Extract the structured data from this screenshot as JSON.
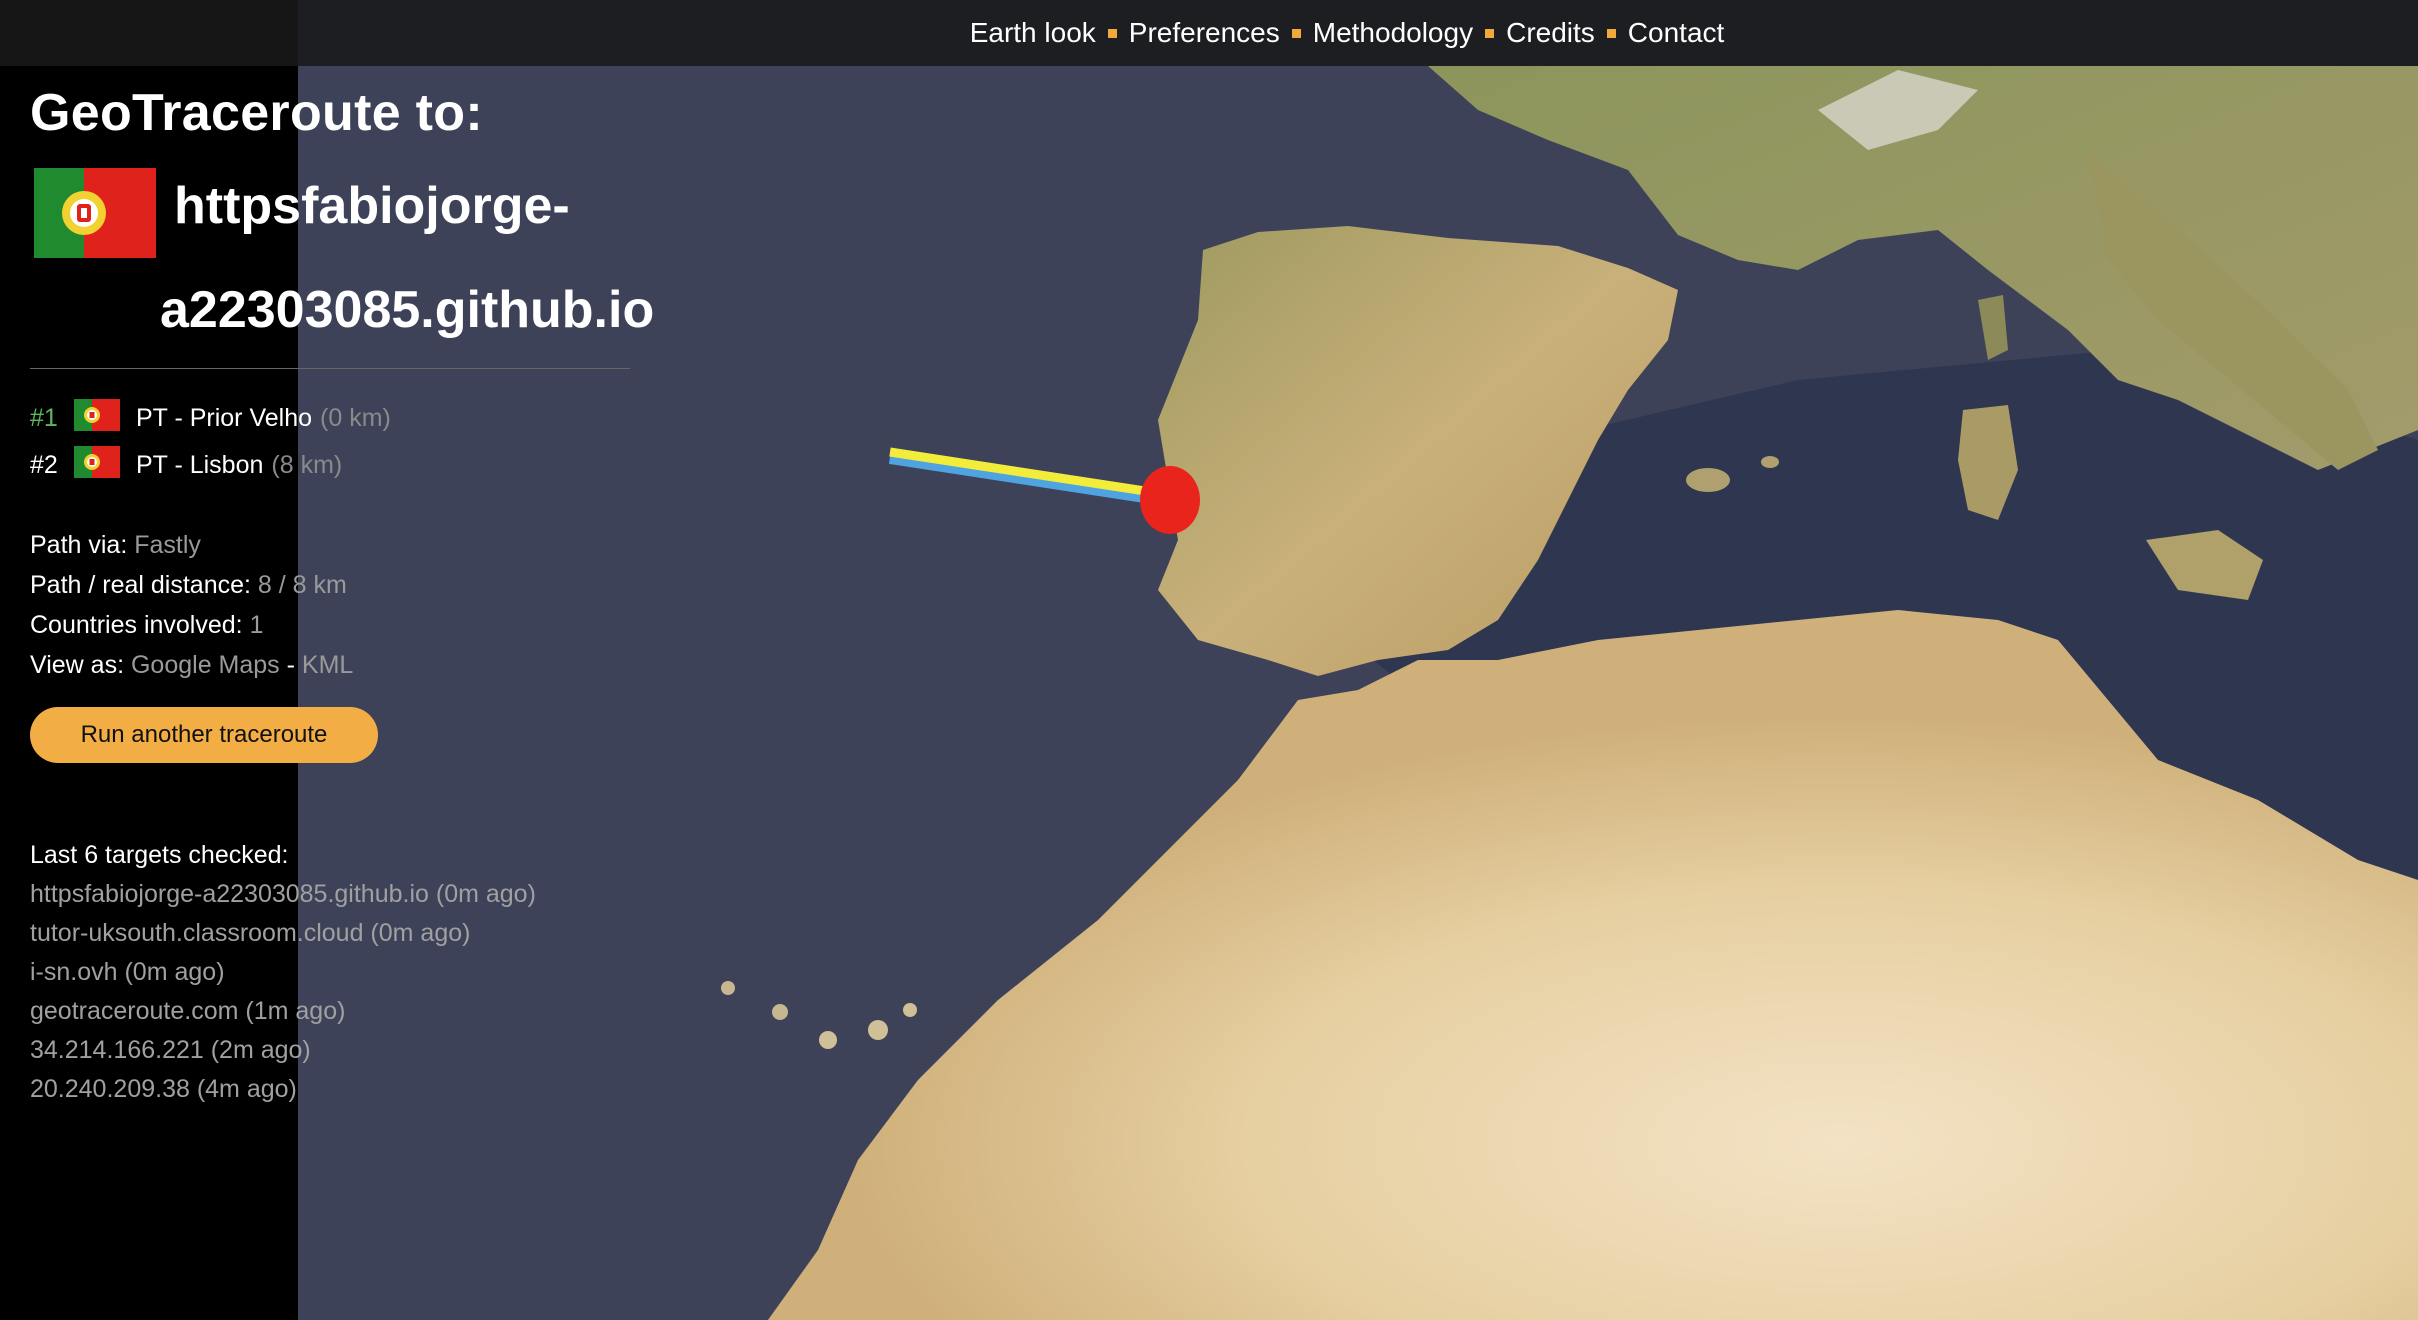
{
  "nav": {
    "items": [
      "Earth look",
      "Preferences",
      "Methodology",
      "Credits",
      "Contact"
    ],
    "separator_color": "#f2a93b"
  },
  "title": "GeoTraceroute to:",
  "target": {
    "flag_icon": "portugal-flag-icon",
    "host_line1": "httpsfabiojorge-",
    "host_line2": "a22303085.github.io"
  },
  "hops": [
    {
      "num": "#1",
      "flag_icon": "portugal-flag-icon",
      "location": "PT - Prior Velho",
      "distance": "(0 km)"
    },
    {
      "num": "#2",
      "flag_icon": "portugal-flag-icon",
      "location": "PT - Lisbon",
      "distance": "(8 km)"
    }
  ],
  "info": {
    "path_via_label": "Path via:",
    "path_via_value": "Fastly",
    "distance_label": "Path / real distance:",
    "distance_value": "8 / 8 km",
    "countries_label": "Countries involved:",
    "countries_value": "1",
    "view_label": "View as:",
    "view_google": "Google Maps",
    "view_sep": "-",
    "view_kml": "KML"
  },
  "run_button": "Run another traceroute",
  "recent": {
    "title": "Last 6 targets checked:",
    "items": [
      "httpsfabiojorge-a22303085.github.io (0m ago)",
      "tutor-uksouth.classroom.cloud (0m ago)",
      "i-sn.ovh (0m ago)",
      "geotraceroute.com (1m ago)",
      "34.214.166.221 (2m ago)",
      "20.240.209.38 (4m ago)"
    ]
  },
  "colors": {
    "accent": "#f2ae45",
    "hop_first": "#5cb85c",
    "marker": "#e8241c",
    "route_yellow": "#f2ec3a",
    "route_blue": "#4fa3e0"
  }
}
